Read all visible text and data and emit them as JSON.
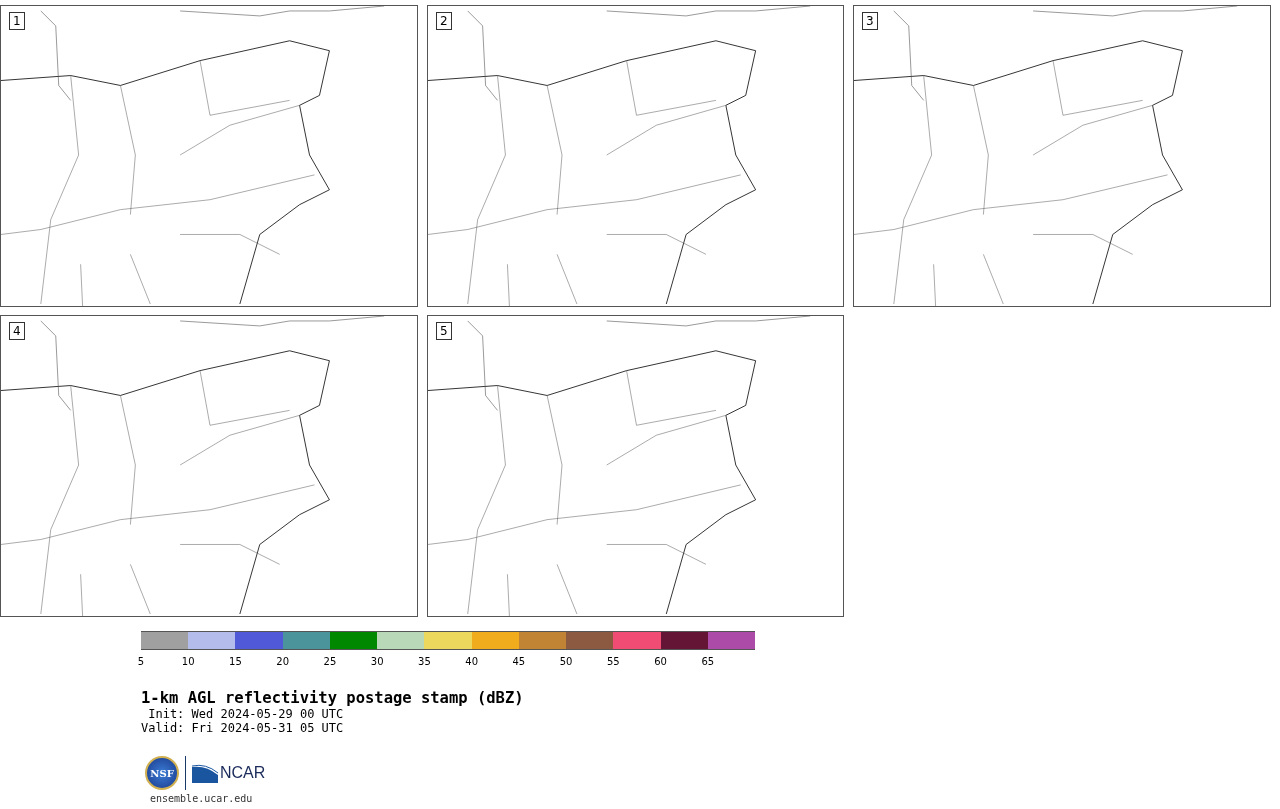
{
  "panels": [
    {
      "label": "1"
    },
    {
      "label": "2"
    },
    {
      "label": "3"
    },
    {
      "label": "4"
    },
    {
      "label": "5"
    }
  ],
  "colorbar": {
    "bins": [
      {
        "color": "#a0a0a0",
        "tick": "5"
      },
      {
        "color": "#b4bcec",
        "tick": "10"
      },
      {
        "color": "#505ad8",
        "tick": "15"
      },
      {
        "color": "#4c949c",
        "tick": "20"
      },
      {
        "color": "#008800",
        "tick": "25"
      },
      {
        "color": "#b8d8b8",
        "tick": "30"
      },
      {
        "color": "#ecd85c",
        "tick": "35"
      },
      {
        "color": "#f0ac1c",
        "tick": "40"
      },
      {
        "color": "#c08434",
        "tick": "45"
      },
      {
        "color": "#8c5a40",
        "tick": "50"
      },
      {
        "color": "#f04c74",
        "tick": "55"
      },
      {
        "color": "#641434",
        "tick": "60"
      },
      {
        "color": "#ac4ca8",
        "tick": "65"
      }
    ]
  },
  "title": "1-km AGL reflectivity postage stamp (dBZ)",
  "init": " Init: Wed 2024-05-29 00 UTC",
  "valid": "Valid: Fri 2024-05-31 05 UTC",
  "logos": {
    "seal_text": "NSF",
    "wordmark": "NCAR"
  },
  "url": "ensemble.ucar.edu"
}
